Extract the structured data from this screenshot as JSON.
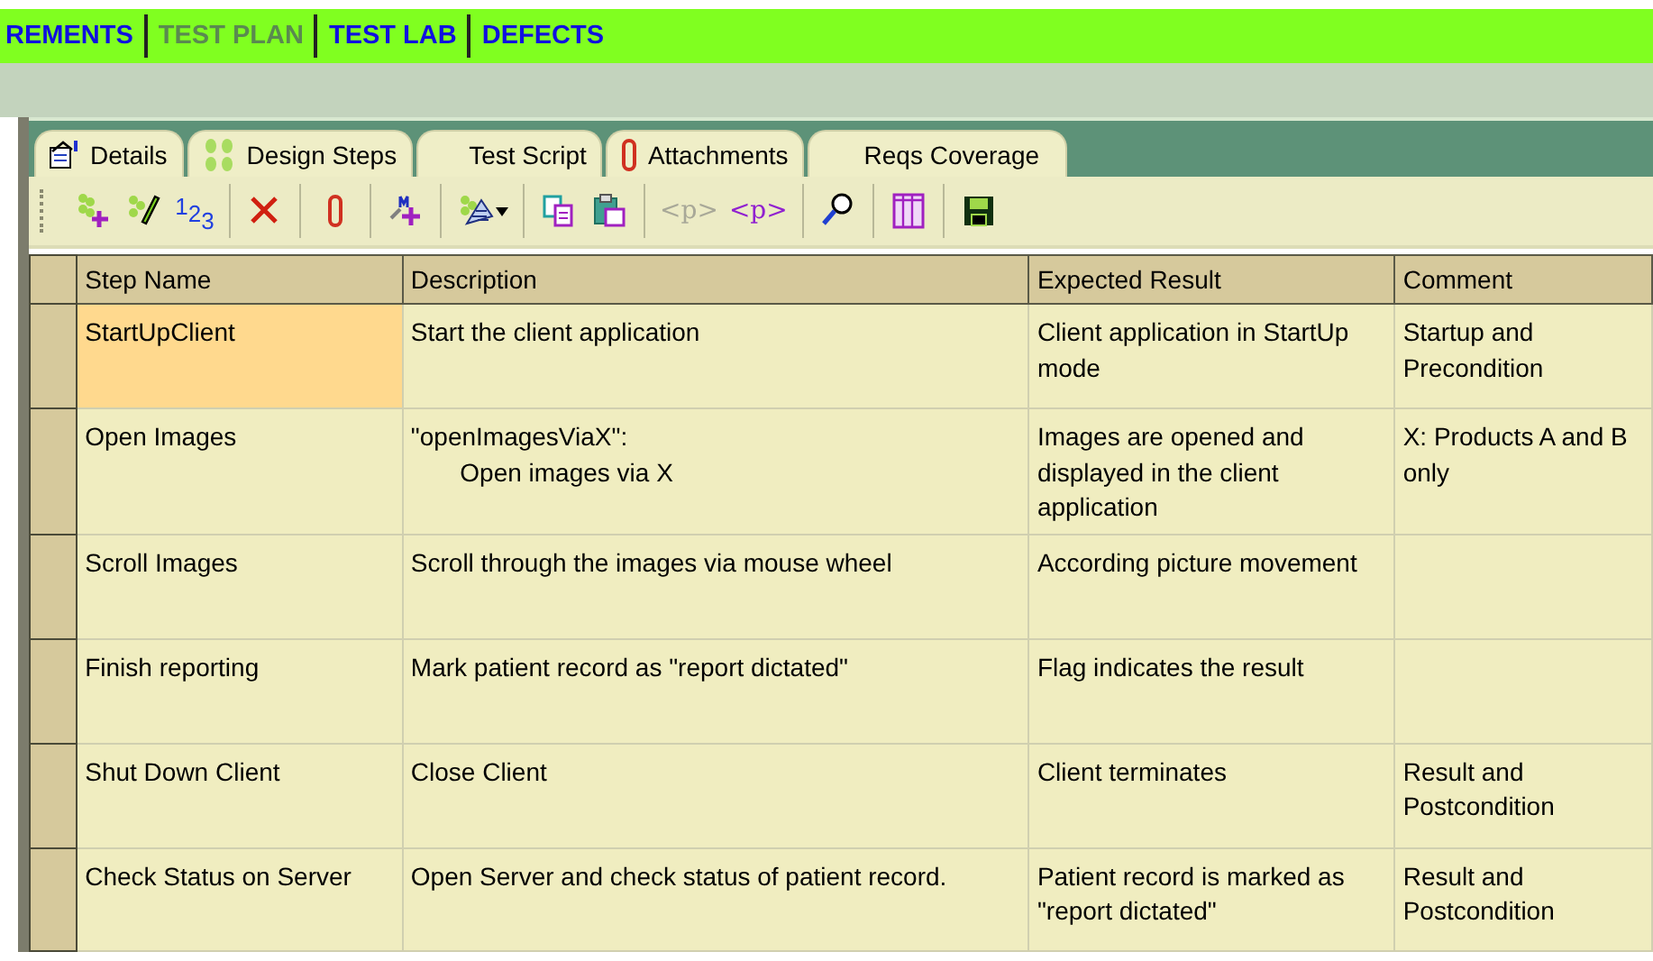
{
  "modules": [
    {
      "label": "REMENTS",
      "selected": false
    },
    {
      "label": "TEST PLAN",
      "selected": true
    },
    {
      "label": "TEST LAB",
      "selected": false
    },
    {
      "label": "DEFECTS",
      "selected": false
    }
  ],
  "tabs": [
    {
      "label": "Details",
      "kind": "details"
    },
    {
      "label": "Design Steps",
      "kind": "steps"
    },
    {
      "label": "Test Script",
      "kind": "script"
    },
    {
      "label": "Attachments",
      "kind": "attach"
    },
    {
      "label": "Reqs Coverage",
      "kind": "reqs"
    }
  ],
  "toolbar": [
    [
      {
        "kind": "add-step"
      },
      {
        "kind": "edit-step"
      },
      {
        "kind": "renumber",
        "text": "123"
      }
    ],
    [
      {
        "kind": "delete"
      }
    ],
    [
      {
        "kind": "attach"
      }
    ],
    [
      {
        "kind": "call-test"
      }
    ],
    [
      {
        "kind": "grid-menu"
      }
    ],
    [
      {
        "kind": "copy"
      },
      {
        "kind": "paste"
      }
    ],
    [
      {
        "kind": "param-insert",
        "text": "<p>",
        "disabled": true
      },
      {
        "kind": "param",
        "text": "<p>",
        "disabled": false
      }
    ],
    [
      {
        "kind": "find"
      }
    ],
    [
      {
        "kind": "columns"
      }
    ],
    [
      {
        "kind": "save"
      }
    ]
  ],
  "table": {
    "columns": [
      "Step Name",
      "Description",
      "Expected Result",
      "Comment"
    ],
    "rows": [
      {
        "selected": true,
        "cells": [
          "StartUpClient",
          "Start the client application",
          "Client application in StartUp mode",
          "Startup and Precondition"
        ]
      },
      {
        "selected": false,
        "cells": [
          "Open Images",
          "\"openImagesViaX\":\n       Open images via X",
          "Images are opened and displayed in the client application",
          "X: Products A and B only"
        ]
      },
      {
        "selected": false,
        "cells": [
          "Scroll Images",
          "Scroll through the images via mouse wheel",
          "According picture movement",
          ""
        ]
      },
      {
        "selected": false,
        "cells": [
          "Finish reporting",
          "Mark patient record as \"report dictated\"",
          "Flag indicates the result",
          ""
        ]
      },
      {
        "selected": false,
        "cells": [
          "Shut Down Client",
          "Close Client",
          "Client terminates",
          "Result and Postcondition"
        ]
      },
      {
        "selected": false,
        "cells": [
          "Check Status on Server",
          "Open Server and check status of patient record.",
          "Patient record is marked as \"report dictated\"",
          "Result and Postcondition"
        ]
      }
    ]
  }
}
